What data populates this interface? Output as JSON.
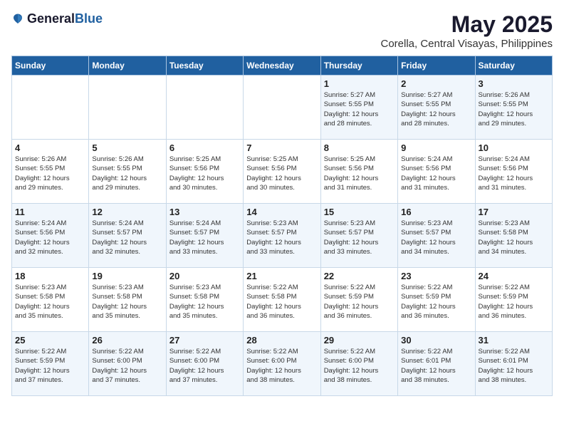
{
  "header": {
    "logo_general": "General",
    "logo_blue": "Blue",
    "title": "May 2025",
    "subtitle": "Corella, Central Visayas, Philippines"
  },
  "days_of_week": [
    "Sunday",
    "Monday",
    "Tuesday",
    "Wednesday",
    "Thursday",
    "Friday",
    "Saturday"
  ],
  "weeks": [
    [
      {
        "day": "",
        "info": ""
      },
      {
        "day": "",
        "info": ""
      },
      {
        "day": "",
        "info": ""
      },
      {
        "day": "",
        "info": ""
      },
      {
        "day": "1",
        "info": "Sunrise: 5:27 AM\nSunset: 5:55 PM\nDaylight: 12 hours\nand 28 minutes."
      },
      {
        "day": "2",
        "info": "Sunrise: 5:27 AM\nSunset: 5:55 PM\nDaylight: 12 hours\nand 28 minutes."
      },
      {
        "day": "3",
        "info": "Sunrise: 5:26 AM\nSunset: 5:55 PM\nDaylight: 12 hours\nand 29 minutes."
      }
    ],
    [
      {
        "day": "4",
        "info": "Sunrise: 5:26 AM\nSunset: 5:55 PM\nDaylight: 12 hours\nand 29 minutes."
      },
      {
        "day": "5",
        "info": "Sunrise: 5:26 AM\nSunset: 5:55 PM\nDaylight: 12 hours\nand 29 minutes."
      },
      {
        "day": "6",
        "info": "Sunrise: 5:25 AM\nSunset: 5:56 PM\nDaylight: 12 hours\nand 30 minutes."
      },
      {
        "day": "7",
        "info": "Sunrise: 5:25 AM\nSunset: 5:56 PM\nDaylight: 12 hours\nand 30 minutes."
      },
      {
        "day": "8",
        "info": "Sunrise: 5:25 AM\nSunset: 5:56 PM\nDaylight: 12 hours\nand 31 minutes."
      },
      {
        "day": "9",
        "info": "Sunrise: 5:24 AM\nSunset: 5:56 PM\nDaylight: 12 hours\nand 31 minutes."
      },
      {
        "day": "10",
        "info": "Sunrise: 5:24 AM\nSunset: 5:56 PM\nDaylight: 12 hours\nand 31 minutes."
      }
    ],
    [
      {
        "day": "11",
        "info": "Sunrise: 5:24 AM\nSunset: 5:56 PM\nDaylight: 12 hours\nand 32 minutes."
      },
      {
        "day": "12",
        "info": "Sunrise: 5:24 AM\nSunset: 5:57 PM\nDaylight: 12 hours\nand 32 minutes."
      },
      {
        "day": "13",
        "info": "Sunrise: 5:24 AM\nSunset: 5:57 PM\nDaylight: 12 hours\nand 33 minutes."
      },
      {
        "day": "14",
        "info": "Sunrise: 5:23 AM\nSunset: 5:57 PM\nDaylight: 12 hours\nand 33 minutes."
      },
      {
        "day": "15",
        "info": "Sunrise: 5:23 AM\nSunset: 5:57 PM\nDaylight: 12 hours\nand 33 minutes."
      },
      {
        "day": "16",
        "info": "Sunrise: 5:23 AM\nSunset: 5:57 PM\nDaylight: 12 hours\nand 34 minutes."
      },
      {
        "day": "17",
        "info": "Sunrise: 5:23 AM\nSunset: 5:58 PM\nDaylight: 12 hours\nand 34 minutes."
      }
    ],
    [
      {
        "day": "18",
        "info": "Sunrise: 5:23 AM\nSunset: 5:58 PM\nDaylight: 12 hours\nand 35 minutes."
      },
      {
        "day": "19",
        "info": "Sunrise: 5:23 AM\nSunset: 5:58 PM\nDaylight: 12 hours\nand 35 minutes."
      },
      {
        "day": "20",
        "info": "Sunrise: 5:23 AM\nSunset: 5:58 PM\nDaylight: 12 hours\nand 35 minutes."
      },
      {
        "day": "21",
        "info": "Sunrise: 5:22 AM\nSunset: 5:58 PM\nDaylight: 12 hours\nand 36 minutes."
      },
      {
        "day": "22",
        "info": "Sunrise: 5:22 AM\nSunset: 5:59 PM\nDaylight: 12 hours\nand 36 minutes."
      },
      {
        "day": "23",
        "info": "Sunrise: 5:22 AM\nSunset: 5:59 PM\nDaylight: 12 hours\nand 36 minutes."
      },
      {
        "day": "24",
        "info": "Sunrise: 5:22 AM\nSunset: 5:59 PM\nDaylight: 12 hours\nand 36 minutes."
      }
    ],
    [
      {
        "day": "25",
        "info": "Sunrise: 5:22 AM\nSunset: 5:59 PM\nDaylight: 12 hours\nand 37 minutes."
      },
      {
        "day": "26",
        "info": "Sunrise: 5:22 AM\nSunset: 6:00 PM\nDaylight: 12 hours\nand 37 minutes."
      },
      {
        "day": "27",
        "info": "Sunrise: 5:22 AM\nSunset: 6:00 PM\nDaylight: 12 hours\nand 37 minutes."
      },
      {
        "day": "28",
        "info": "Sunrise: 5:22 AM\nSunset: 6:00 PM\nDaylight: 12 hours\nand 38 minutes."
      },
      {
        "day": "29",
        "info": "Sunrise: 5:22 AM\nSunset: 6:00 PM\nDaylight: 12 hours\nand 38 minutes."
      },
      {
        "day": "30",
        "info": "Sunrise: 5:22 AM\nSunset: 6:01 PM\nDaylight: 12 hours\nand 38 minutes."
      },
      {
        "day": "31",
        "info": "Sunrise: 5:22 AM\nSunset: 6:01 PM\nDaylight: 12 hours\nand 38 minutes."
      }
    ]
  ]
}
